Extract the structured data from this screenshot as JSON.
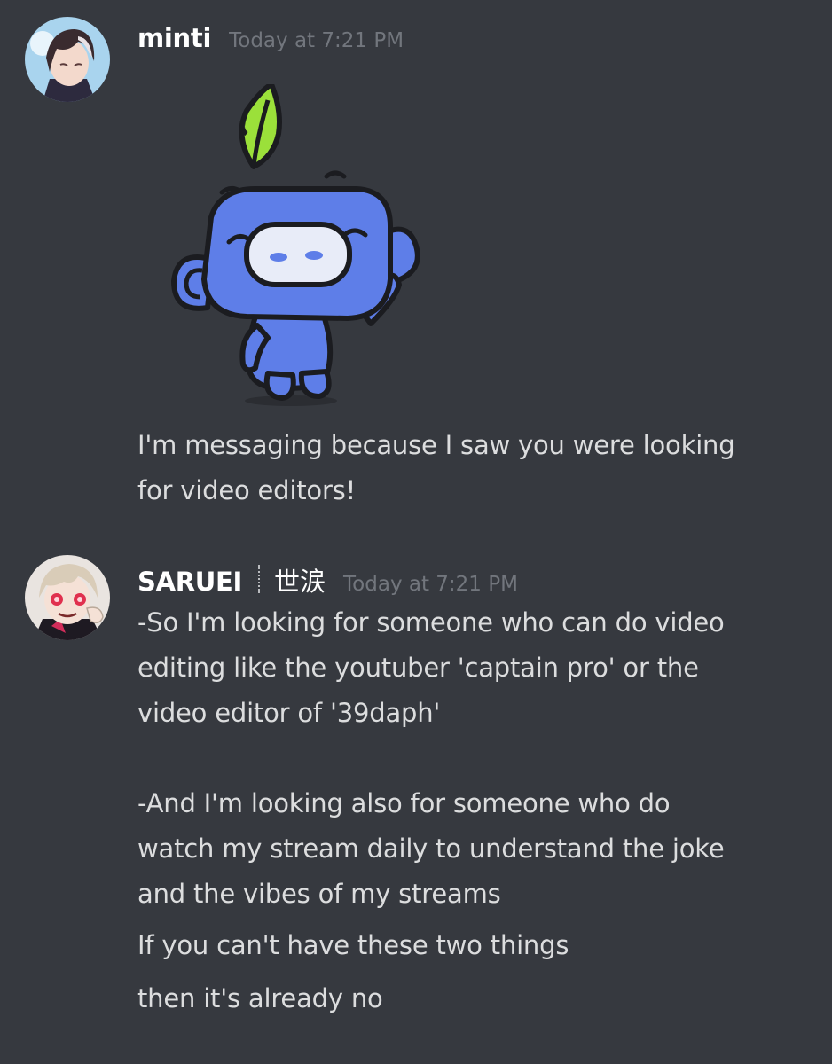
{
  "messages": [
    {
      "username": "minti",
      "timestamp": "Today at 7:21 PM",
      "avatar_icon": "anime-avatar-dark-hair",
      "sticker": "wumpus-waving-leaf-sticker",
      "lines": [
        "I'm messaging because I saw you were looking",
        "for video editors!"
      ]
    },
    {
      "username": "SARUEI",
      "usertag": "世涙",
      "timestamp": "Today at 7:21 PM",
      "avatar_icon": "anime-avatar-light-hair",
      "lines": [
        "-So I'm looking for someone who can do video",
        "editing like the youtuber 'captain pro' or the",
        "video editor of '39daph'",
        "-And I'm looking also for someone who do",
        "watch my stream daily to understand the joke",
        "and the vibes of my streams",
        "If you can't have these two things",
        "then it's already no"
      ]
    }
  ],
  "colors": {
    "background": "#36393f",
    "username": "#ffffff",
    "message_text": "#dcddde",
    "timestamp": "#72767d"
  }
}
